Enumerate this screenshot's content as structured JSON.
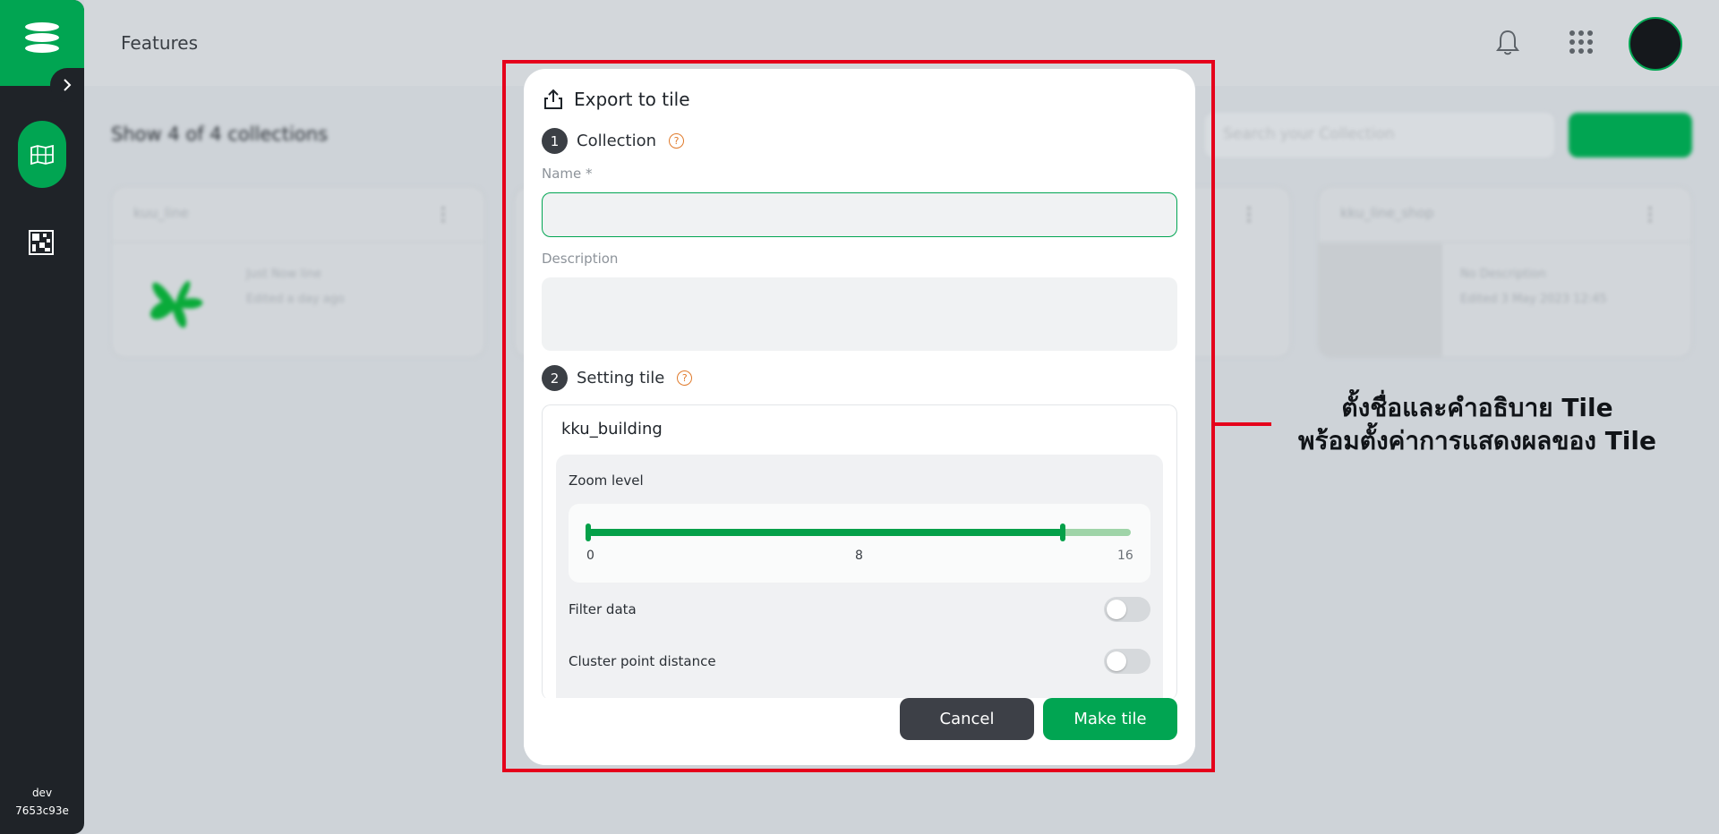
{
  "header": {
    "title": "Features"
  },
  "sidebar": {
    "footer_env": "dev",
    "footer_hash": "7653c93e"
  },
  "background": {
    "count_text": "Show 4 of 4 collections",
    "search_placeholder": "Search your Collection",
    "cards": [
      {
        "title": "kuu_line",
        "meta1": "Just Now line",
        "meta2": "Edited a day ago"
      },
      {
        "title": "kku_line_shop",
        "meta1": "No Description",
        "meta2": "Edited 3 May 2023 12:45"
      }
    ]
  },
  "dialog": {
    "title": "Export to tile",
    "step1": {
      "number": "1",
      "label": "Collection"
    },
    "name_label": "Name *",
    "name_value": "",
    "description_label": "Description",
    "description_value": "",
    "step2": {
      "number": "2",
      "label": "Setting tile"
    },
    "tile_name": "kku_building",
    "zoom_label": "Zoom level",
    "zoom": {
      "min": 0,
      "max": 16,
      "mid_tick": "8",
      "min_tick": "0",
      "max_tick": "16",
      "value_low": 0,
      "value_high": 14
    },
    "filter_label": "Filter data",
    "filter_on": false,
    "cluster_label": "Cluster point distance",
    "cluster_on": false,
    "cancel_label": "Cancel",
    "make_label": "Make tile"
  },
  "annotation": {
    "line1": "ตั้งชื่อและคำอธิบาย Tile",
    "line2": "พร้อมตั้งค่าการแสดงผลของ Tile",
    "color": "#e5001b"
  },
  "colors": {
    "brand": "#01a552",
    "sidebar": "#1f2328"
  }
}
